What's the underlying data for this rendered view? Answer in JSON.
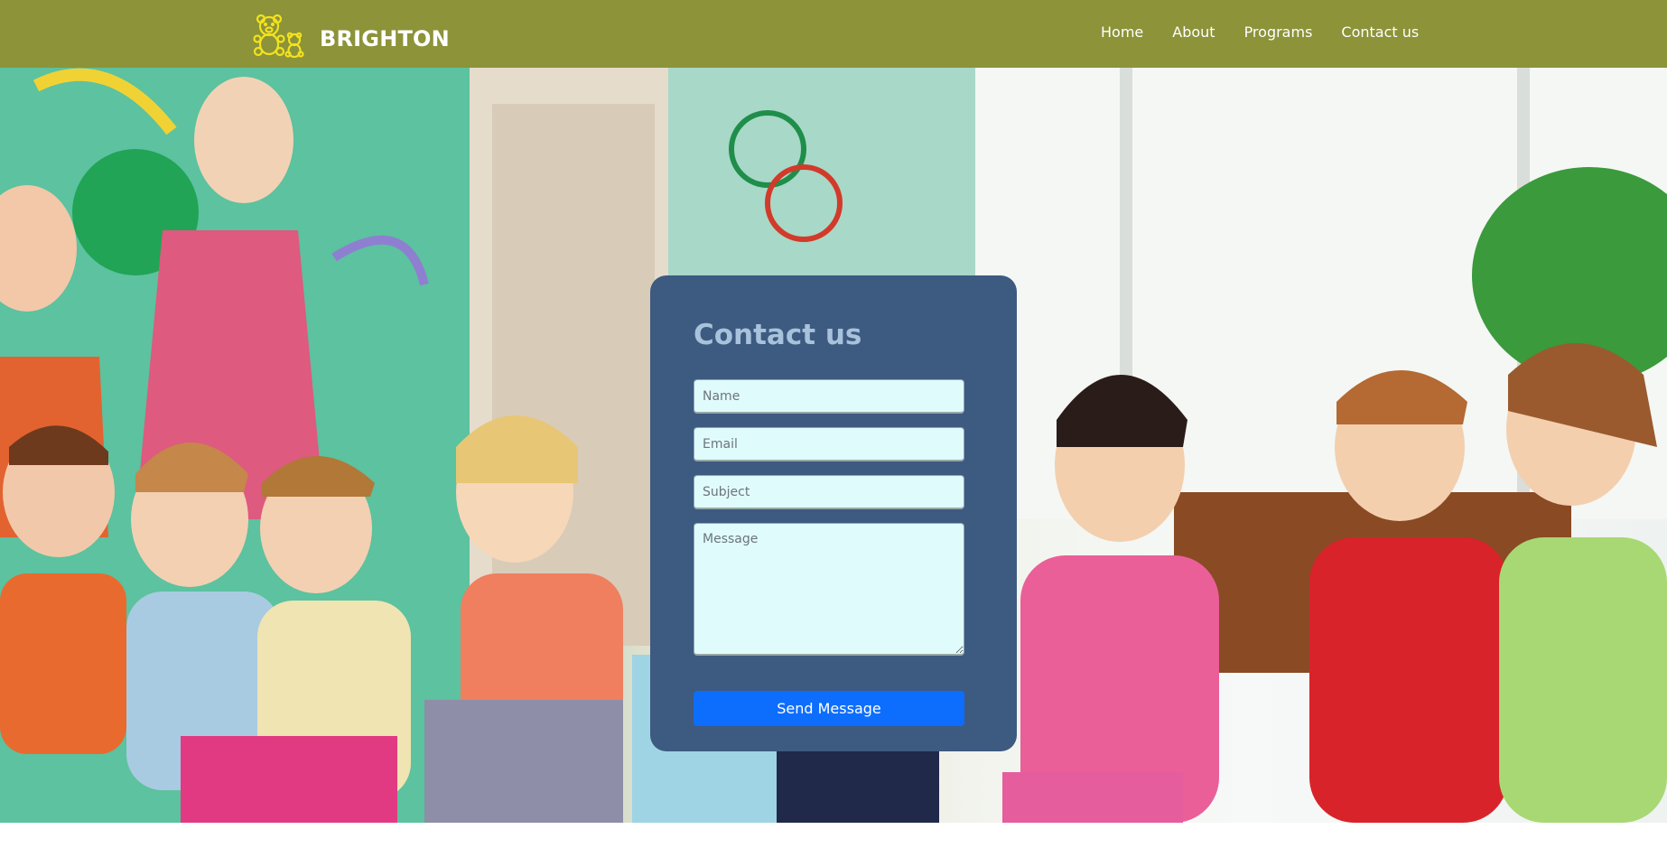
{
  "navbar": {
    "brand": "BRIGHTON",
    "brand_icon": "teddy-bear-icon",
    "links": [
      "Home",
      "About",
      "Programs",
      "Contact us"
    ],
    "background_color": "#8c9339"
  },
  "hero": {
    "image": "photo-of-smiling-children-sitting-in-classroom"
  },
  "contact_form": {
    "title": "Contact us",
    "name_placeholder": "Name",
    "email_placeholder": "Email",
    "subject_placeholder": "Subject",
    "message_placeholder": "Message",
    "submit_label": "Send Message",
    "card_color": "#3d5a80",
    "button_color": "#0d6efd"
  }
}
